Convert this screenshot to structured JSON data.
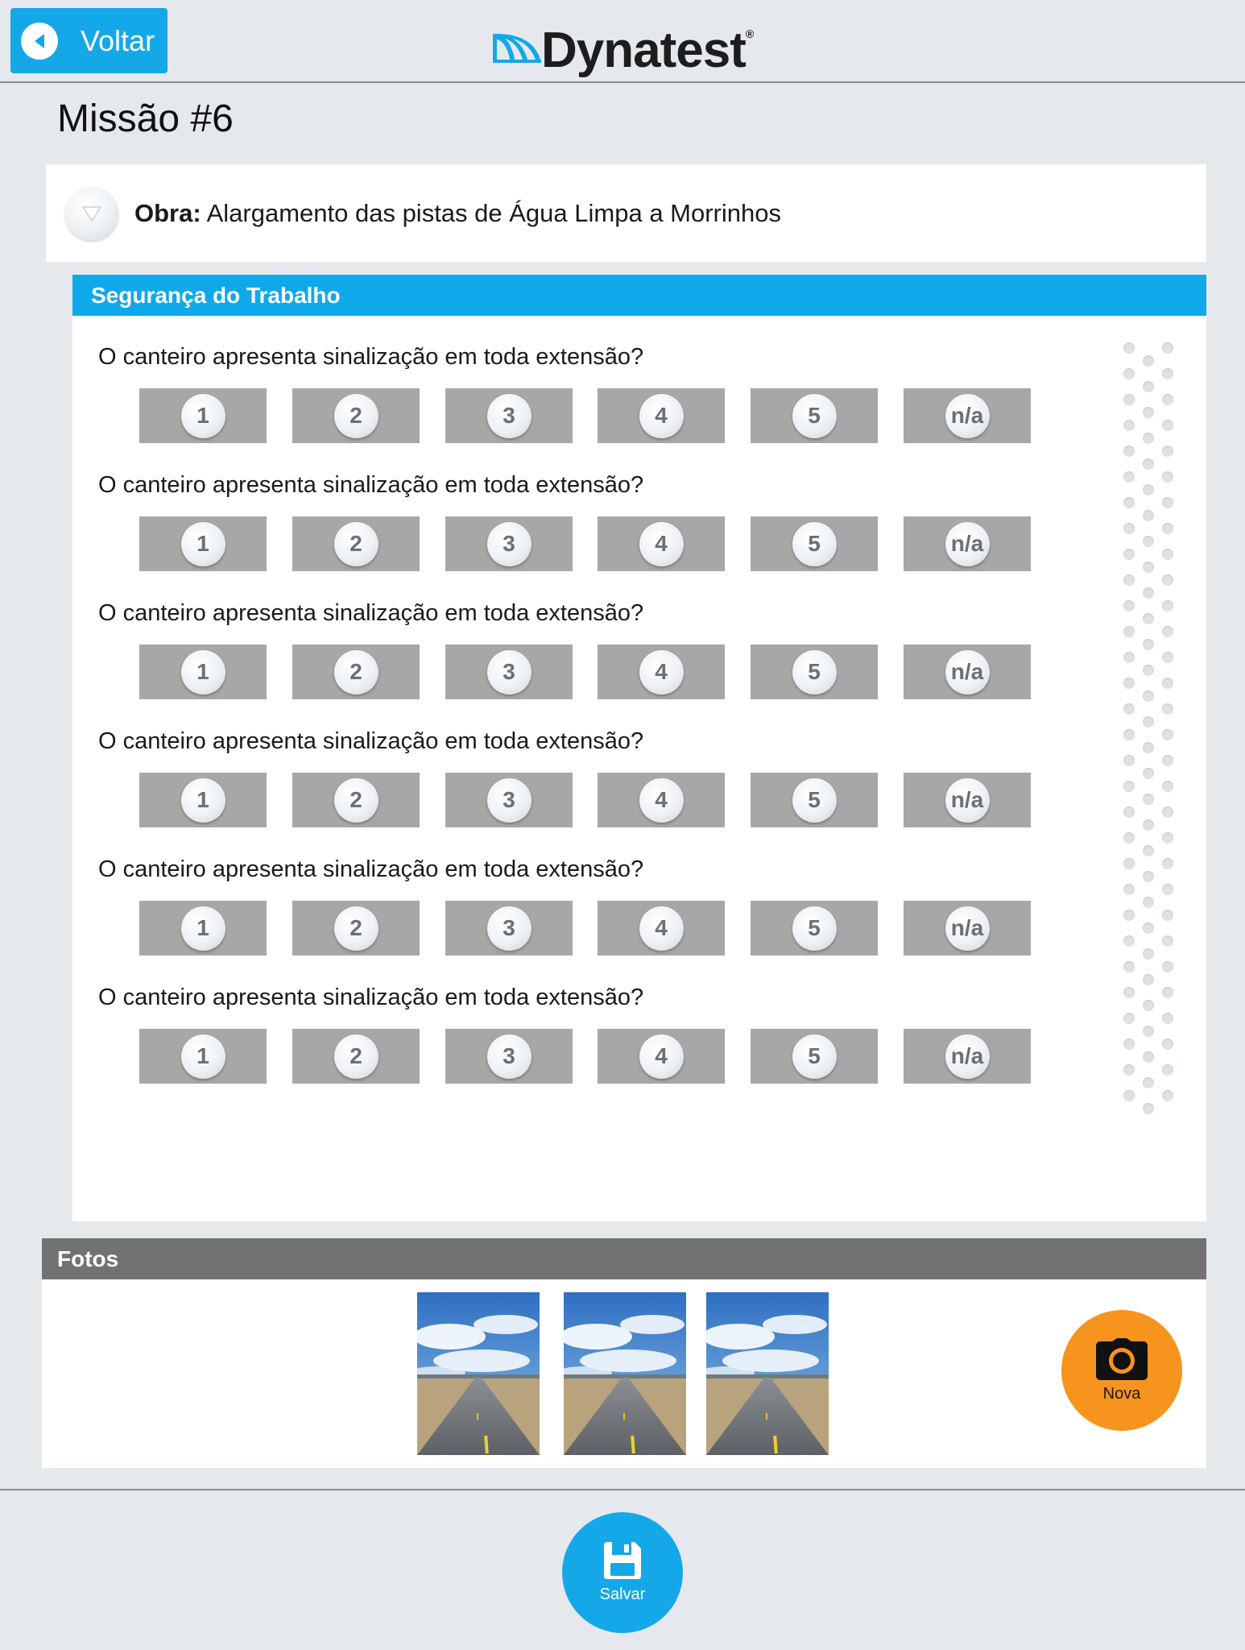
{
  "header": {
    "back_label": "Voltar",
    "logo_text": "Dynatest",
    "logo_mark": "®"
  },
  "page": {
    "title": "Missão #6"
  },
  "obra": {
    "label": "Obra:",
    "value": "Alargamento das pistas de Água Limpa a Morrinhos"
  },
  "section": {
    "title": "Segurança do Trabalho",
    "questions": [
      {
        "text": "O canteiro apresenta sinalização em toda extensão?",
        "options": [
          "1",
          "2",
          "3",
          "4",
          "5",
          "n/a"
        ]
      },
      {
        "text": "O canteiro apresenta sinalização em toda extensão?",
        "options": [
          "1",
          "2",
          "3",
          "4",
          "5",
          "n/a"
        ]
      },
      {
        "text": "O canteiro apresenta sinalização em toda extensão?",
        "options": [
          "1",
          "2",
          "3",
          "4",
          "5",
          "n/a"
        ]
      },
      {
        "text": "O canteiro apresenta sinalização em toda extensão?",
        "options": [
          "1",
          "2",
          "3",
          "4",
          "5",
          "n/a"
        ]
      },
      {
        "text": "O canteiro apresenta sinalização em toda extensão?",
        "options": [
          "1",
          "2",
          "3",
          "4",
          "5",
          "n/a"
        ]
      },
      {
        "text": "O canteiro apresenta sinalização em toda extensão?",
        "options": [
          "1",
          "2",
          "3",
          "4",
          "5",
          "n/a"
        ]
      }
    ]
  },
  "fotos": {
    "title": "Fotos",
    "photo_count": 3,
    "new_label": "Nova"
  },
  "footer": {
    "save_label": "Salvar"
  },
  "colors": {
    "accent": "#14a8e8",
    "section_header": "#0fa9eb",
    "fotos_header": "#727272",
    "option_bg": "#a7a7a7",
    "nova_button": "#f7941e",
    "background": "#e5e9ed"
  },
  "icons": {
    "back": "chevron-left-icon",
    "toggle": "triangle-down-icon",
    "camera": "camera-icon",
    "save": "floppy-disk-icon"
  }
}
